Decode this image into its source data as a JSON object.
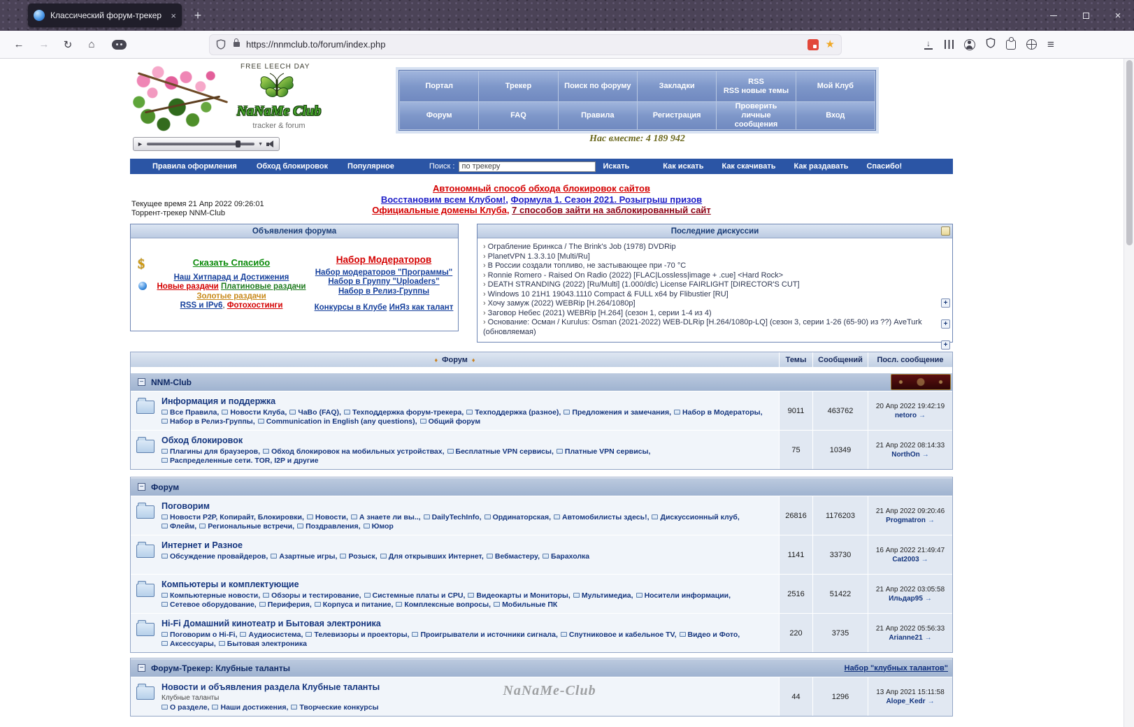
{
  "browser": {
    "tab_title": "Классический форум-трекер",
    "url": "https://nnmclub.to/forum/index.php"
  },
  "icons": {
    "back": "←",
    "forward": "→",
    "refresh": "↻",
    "home": "⌂",
    "menu": "≡",
    "bookmark_star": "★",
    "download": "↓",
    "new_tab": "+",
    "tab_close": "×",
    "window_close": "×",
    "play": "►",
    "dropdown": "▼",
    "dollar": "$",
    "collapse": "−",
    "plus": "+",
    "diamond": "♦",
    "topic_prefix": "›",
    "goto_arrow": "→"
  },
  "header": {
    "free_leech": "FREE LEECH DAY",
    "logo_title": "NaNaMe Club",
    "logo_subtitle": "tracker & forum",
    "together": "Нас вместе: 4 189 942",
    "menu_row1": [
      {
        "t": "Портал"
      },
      {
        "t": "Трекер"
      },
      {
        "t": "Поиск по форуму"
      },
      {
        "t": "Закладки"
      },
      {
        "t": "RSS",
        "t2": "RSS новые темы"
      },
      {
        "t": "Мой Клуб"
      }
    ],
    "menu_row2": [
      {
        "t": "Форум"
      },
      {
        "t": "FAQ"
      },
      {
        "t": "Правила"
      },
      {
        "t": "Регистрация"
      },
      {
        "t": "Проверить личные сообщения"
      },
      {
        "t": "Вход"
      }
    ]
  },
  "navbar": {
    "links_left": [
      "Правила оформления",
      "Обход блокировок",
      "Популярное"
    ],
    "search_label": "Поиск :",
    "search_value": "по трекеру",
    "search_button": "Искать",
    "links_right": [
      "Как искать",
      "Как скачивать",
      "Как раздавать",
      "Спасибо!"
    ]
  },
  "announce": {
    "line1": "Автономный способ обхода блокировок сайтов",
    "line2a": "Восстановим всем Клубом!,",
    "line2b": "Формула 1. Сезон 2021. Розыгрыш призов",
    "line3a": "Официальные домены Клуба,",
    "line3b": "7 способов зайти на заблокированный сайт"
  },
  "meta": {
    "time": "Текущее время 21 Апр 2022 09:26:01",
    "tracker": "Торрент-трекер NNM-Club"
  },
  "announcements_panel": {
    "title": "Объявления форума",
    "thanks": "Сказать Спасибо",
    "hitparade": "Наш Хитпарад и Достижения",
    "new_releases": "Новые раздачи",
    "platinum": "Платиновые раздачи",
    "gold": "Золотые раздачи",
    "rss_ipv6": "RSS и IPv6",
    "comma": ", ",
    "photo": "Фотохостинги",
    "mods": "Набор Модераторов",
    "mods_prog": "Набор модераторов \"Программы\"",
    "uploaders": "Набор в Группу \"Uploaders\"",
    "release_groups": "Набор в Релиз-Группы",
    "contests": "Конкурсы в Клубе",
    "inyaz": "ИнЯз как талант"
  },
  "discussions": {
    "title": "Последние дискуссии",
    "topics": [
      "Ограбление Бринкса / The Brink's Job (1978) DVDRip",
      "PlanetVPN 1.3.3.10 [Multi/Ru]",
      "В России создали топливо, не застывающее при -70 °C",
      "Ronnie Romero - Raised On Radio (2022) [FLAC|Lossless|image + .cue] <Hard Rock>",
      "DEATH STRANDING (2022) [Ru/Multi] (1.000/dlc) License FAIRLIGHT [DIRECTOR'S CUT]",
      "Windows 10 21H1 19043.1110 Compact & FULL x64 by Flibustier [RU]",
      "Хочу замуж (2022) WEBRip [H.264/1080p]",
      "Заговор Небес (2021) WEBRip [H.264] (сезон 1, серии 1-4 из 4)",
      "Основание: Осман / Kurulus: Osman (2021-2022) WEB-DLRip [H.264/1080p-LQ] (сезон 3, серии 1-26 (65-90) из ??) AveTurk (обновляемая)"
    ]
  },
  "table_header": {
    "forum": "Форум",
    "topics": "Темы",
    "posts": "Сообщений",
    "last_post": "Посл. сообщение"
  },
  "sections": [
    {
      "title": "NNM-Club",
      "rows": [
        {
          "name": "Информация и поддержка",
          "subforums": [
            "Все Правила",
            "Новости Клуба",
            "ЧаВо (FAQ)",
            "Техподдержка форум-трекера",
            "Техподдержка (разное)",
            "Предложения и замечания",
            "Набор в Модераторы",
            "Набор в Релиз-Группы",
            "Communication in English (any questions)",
            "Общий форум"
          ],
          "topics": "9011",
          "posts": "463762",
          "last_date": "20 Апр 2022 19:42:19",
          "last_user": "netoro"
        },
        {
          "name": "Обход блокировок",
          "subforums": [
            "Плагины для браузеров",
            "Обход блокировок на мобильных устройствах",
            "Бесплатные VPN сервисы",
            "Платные VPN сервисы",
            "Распределенные сети. TOR, I2P и другие"
          ],
          "topics": "75",
          "posts": "10349",
          "last_date": "21 Апр 2022 08:14:33",
          "last_user": "NorthOn"
        }
      ]
    },
    {
      "title": "Форум",
      "rows": [
        {
          "name": "Поговорим",
          "subforums": [
            "Новости P2P, Копирайт, Блокировки",
            "Новости",
            "А знаете ли вы..",
            "DailyTechInfo",
            "Ординаторская",
            "Автомобилисты здесь!",
            "Дискуссионный клуб",
            "Флейм",
            "Региональные встречи",
            "Поздравления",
            "Юмор"
          ],
          "topics": "26816",
          "posts": "1176203",
          "last_date": "21 Апр 2022 09:20:46",
          "last_user": "Progmatron"
        },
        {
          "name": "Интернет и Разное",
          "subforums": [
            "Обсуждение провайдеров",
            "Азартные игры",
            "Розыск",
            "Для открывших Интернет",
            "Вебмастеру",
            "Барахолка"
          ],
          "topics": "1141",
          "posts": "33730",
          "last_date": "16 Апр 2022 21:49:47",
          "last_user": "Cat2003"
        },
        {
          "name": "Компьютеры и комплектующие",
          "subforums": [
            "Компьютерные новости",
            "Обзоры и тестирование",
            "Системные платы и CPU",
            "Видеокарты и Мониторы",
            "Мультимедиа",
            "Носители информации",
            "Сетевое оборудование",
            "Периферия",
            "Корпуса и питание",
            "Комплексные вопросы",
            "Мобильные ПК"
          ],
          "topics": "2516",
          "posts": "51422",
          "last_date": "21 Апр 2022 03:05:58",
          "last_user": "Ильдар95"
        },
        {
          "name": "Hi-Fi Домашний кинотеатр и Бытовая электроника",
          "subforums": [
            "Поговорим о Hi-Fi",
            "Аудиосистема",
            "Телевизоры и проекторы",
            "Проигрыватели и источники сигнала",
            "Спутниковое и кабельное TV",
            "Видео и Фото",
            "Аксессуары",
            "Бытовая электроника"
          ],
          "topics": "220",
          "posts": "3735",
          "last_date": "21 Апр 2022 05:56:33",
          "last_user": "Arianne21"
        }
      ]
    },
    {
      "title": "Форум-Трекер: Клубные таланты",
      "header_link": "Набор \"клубных талантов\"",
      "rows": [
        {
          "name": "Новости и объявления раздела Клубные таланты",
          "desc": "Клубные таланты",
          "subforums": [
            "О разделе",
            "Наши достижения",
            "Творческие конкурсы"
          ],
          "topics": "44",
          "posts": "1296",
          "last_date": "13 Апр 2021 15:11:58",
          "last_user": "Alope_Kedr"
        }
      ]
    }
  ],
  "watermark": "NaNaMe-Club"
}
